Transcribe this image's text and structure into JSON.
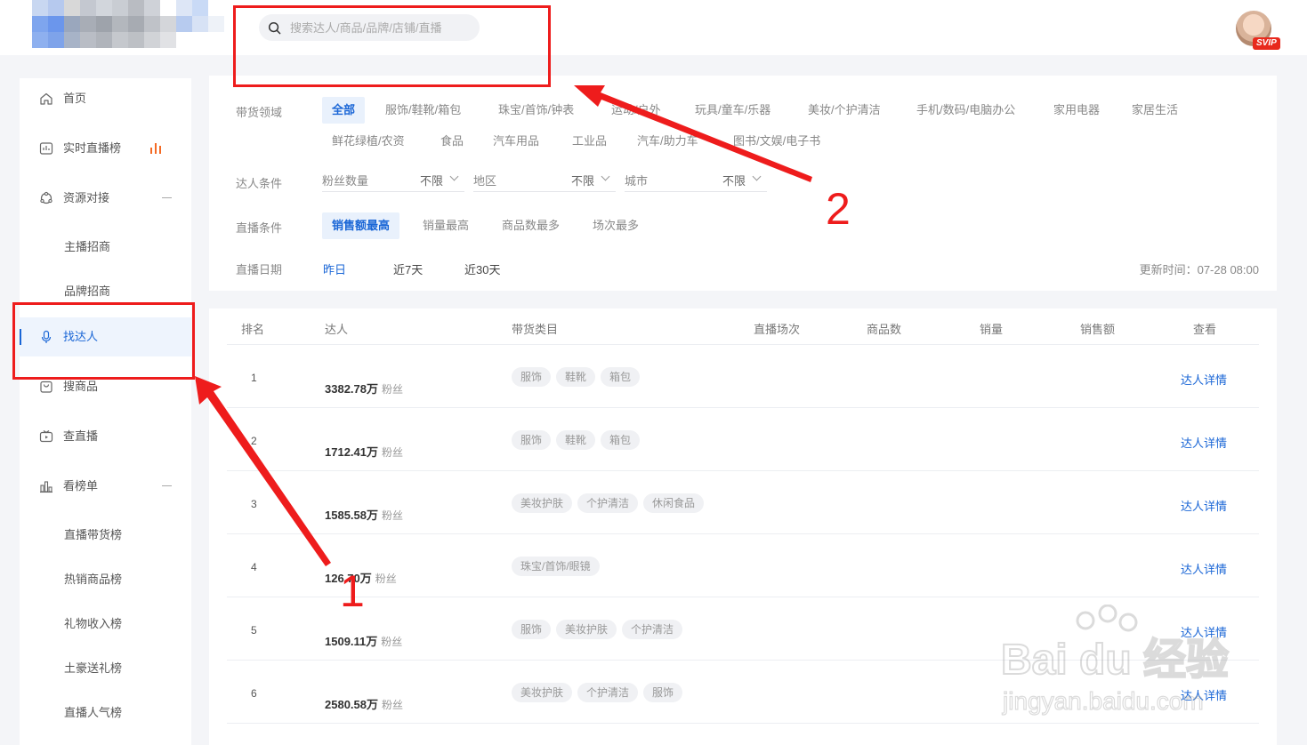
{
  "header": {
    "search_placeholder": "搜索达人/商品/品牌/店铺/直播",
    "vip_badge": "SVIP"
  },
  "sidebar": {
    "items": [
      {
        "label": "首页"
      },
      {
        "label": "实时直播榜"
      },
      {
        "label": "资源对接"
      },
      {
        "label": "主播招商"
      },
      {
        "label": "品牌招商"
      },
      {
        "label": "找达人"
      },
      {
        "label": "搜商品"
      },
      {
        "label": "查直播"
      },
      {
        "label": "看榜单"
      },
      {
        "label": "直播带货榜"
      },
      {
        "label": "热销商品榜"
      },
      {
        "label": "礼物收入榜"
      },
      {
        "label": "土豪送礼榜"
      },
      {
        "label": "直播人气榜"
      }
    ]
  },
  "filters": {
    "domain_label": "带货领域",
    "domains": [
      "全部",
      "服饰/鞋靴/箱包",
      "珠宝/首饰/钟表",
      "运动/户外",
      "玩具/童车/乐器",
      "美妆/个护清洁",
      "手机/数码/电脑办公",
      "家用电器",
      "家居生活",
      "鲜花绿植/农资",
      "食品",
      "汽车用品",
      "工业品",
      "汽车/助力车",
      "图书/文娱/电子书"
    ],
    "condition_label": "达人条件",
    "dropdowns": [
      {
        "label": "粉丝数量",
        "value": "不限"
      },
      {
        "label": "地区",
        "value": "不限"
      },
      {
        "label": "城市",
        "value": "不限"
      }
    ],
    "live_label": "直播条件",
    "sorts": [
      "销售额最高",
      "销量最高",
      "商品数最多",
      "场次最多"
    ],
    "date_label": "直播日期",
    "dates": [
      "昨日",
      "近7天",
      "近30天"
    ],
    "update_time": "更新时间：07-28 08:00"
  },
  "table": {
    "headers": [
      "排名",
      "达人",
      "带货类目",
      "直播场次",
      "商品数",
      "销量",
      "销售额",
      "查看"
    ],
    "fans_unit": "粉丝",
    "detail_label": "达人详情",
    "rows": [
      {
        "rank": "1",
        "fans": "3382.78万",
        "tags": [
          "服饰",
          "鞋靴",
          "箱包"
        ]
      },
      {
        "rank": "2",
        "fans": "1712.41万",
        "tags": [
          "服饰",
          "鞋靴",
          "箱包"
        ]
      },
      {
        "rank": "3",
        "fans": "1585.58万",
        "tags": [
          "美妆护肤",
          "个护清洁",
          "休闲食品"
        ]
      },
      {
        "rank": "4",
        "fans": "126.70万",
        "tags": [
          "珠宝/首饰/眼镜"
        ]
      },
      {
        "rank": "5",
        "fans": "1509.11万",
        "tags": [
          "服饰",
          "美妆护肤",
          "个护清洁"
        ]
      },
      {
        "rank": "6",
        "fans": "2580.58万",
        "tags": [
          "美妆护肤",
          "个护清洁",
          "服饰"
        ]
      }
    ]
  },
  "annotations": {
    "step1": "1",
    "step2": "2"
  },
  "watermark": {
    "brand": "Bai du 经验",
    "url": "jingyan.baidu.com"
  }
}
